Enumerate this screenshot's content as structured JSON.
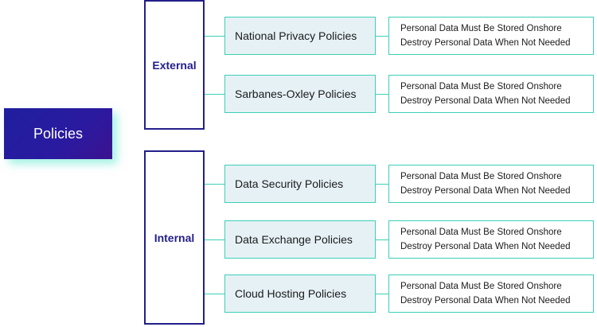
{
  "root": {
    "label": "Policies"
  },
  "groups": [
    {
      "label": "External",
      "policies": [
        {
          "label": "National Privacy Policies",
          "details": [
            "Personal Data Must Be Stored Onshore",
            "Destroy Personal Data When Not Needed"
          ]
        },
        {
          "label": "Sarbanes-Oxley Policies",
          "details": [
            "Personal Data Must Be Stored Onshore",
            "Destroy Personal Data When Not Needed"
          ]
        }
      ]
    },
    {
      "label": "Internal",
      "policies": [
        {
          "label": "Data Security Policies",
          "details": [
            "Personal Data Must Be Stored Onshore",
            "Destroy Personal Data When Not Needed"
          ]
        },
        {
          "label": "Data Exchange Policies",
          "details": [
            "Personal Data Must Be Stored Onshore",
            "Destroy Personal Data When Not Needed"
          ]
        },
        {
          "label": "Cloud Hosting Policies",
          "details": [
            "Personal Data Must Be Stored Onshore",
            "Destroy Personal Data When Not Needed"
          ]
        }
      ]
    }
  ],
  "colors": {
    "root_fill": "#2a1aa0",
    "group_border": "#231f8a",
    "connector": "#3ccfb7",
    "policy_fill": "#e6f1f6"
  }
}
